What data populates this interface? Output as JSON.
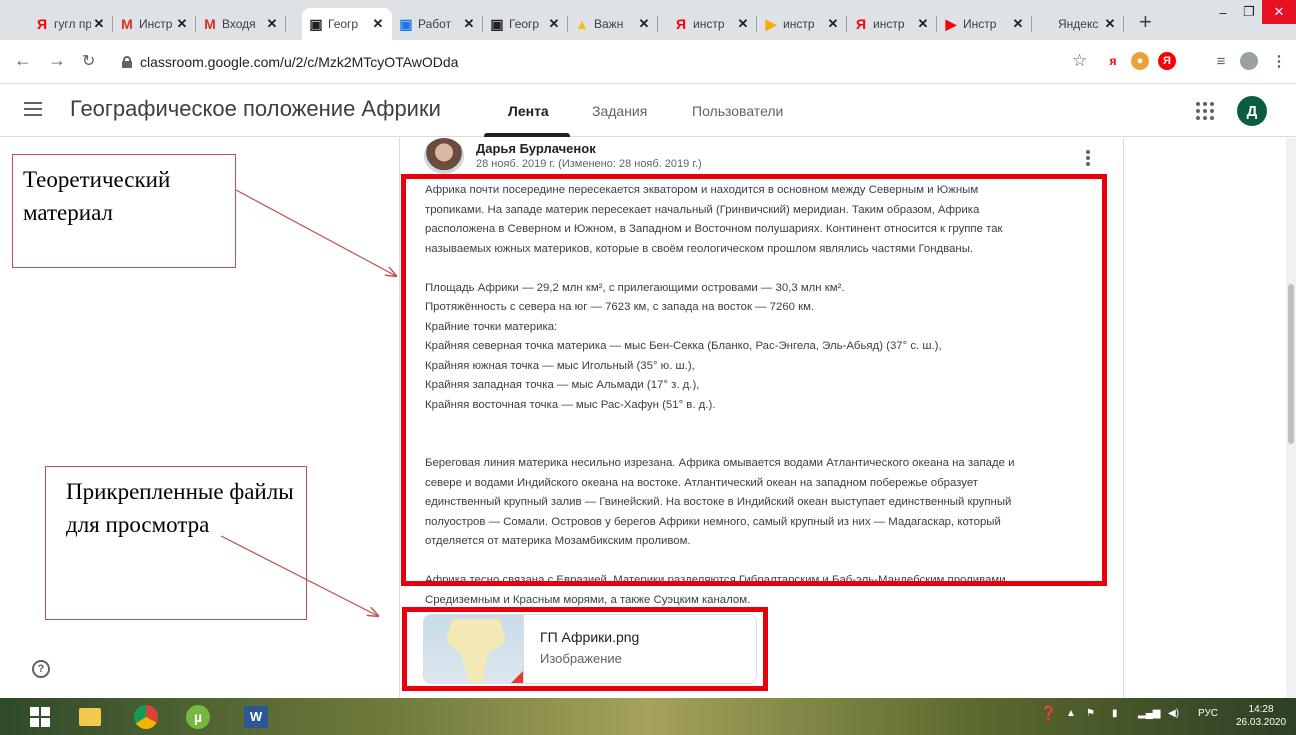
{
  "browser": {
    "tabs": [
      {
        "icon": "Я",
        "icon_color": "#ff0000",
        "title": "гугл пр",
        "active": false
      },
      {
        "icon": "M",
        "icon_color": "#d93025",
        "title": "Инстр",
        "active": false
      },
      {
        "icon": "M",
        "icon_color": "#d93025",
        "title": "Входя",
        "active": false
      },
      {
        "icon": "▣",
        "icon_color": "#202124",
        "title": "Геогр",
        "active": true
      },
      {
        "icon": "▣",
        "icon_color": "#1a73e8",
        "title": "Работ",
        "active": false
      },
      {
        "icon": "▣",
        "icon_color": "#202124",
        "title": "Геогр",
        "active": false
      },
      {
        "icon": "▲",
        "icon_color": "#fbbc04",
        "title": "Важн",
        "active": false
      },
      {
        "icon": "Я",
        "icon_color": "#ff0000",
        "title": "инстр",
        "active": false
      },
      {
        "icon": "▶",
        "icon_color": "#f9ab00",
        "title": "инстр",
        "active": false
      },
      {
        "icon": "Я",
        "icon_color": "#ff0000",
        "title": "инстр",
        "active": false
      },
      {
        "icon": "▶",
        "icon_color": "#ff0000",
        "title": "Инстр",
        "active": false
      },
      {
        "icon": "",
        "icon_color": "#202124",
        "title": "Яндекс",
        "active": false
      }
    ],
    "new_tab": "+",
    "minimize": "–",
    "maximize": "❐",
    "close": "✕",
    "url": "classroom.google.com/u/2/c/Mzk2MTcyOTAwODda",
    "star": "☆"
  },
  "header": {
    "course_title": "Географическое положение Африки",
    "tabs": [
      "Лента",
      "Задания",
      "Пользователи"
    ],
    "active_tab": "Лента",
    "avatar_letter": "Д"
  },
  "post": {
    "author": "Дарья Бурлаченок",
    "date": "28 нояб. 2019 г. (Изменено: 28 нояб. 2019 г.)",
    "paragraphs": [
      "Африка почти посередине пересекается экватором и находится в основном между Северным и Южным",
      "тропиками. На западе материк пересекает начальный (Гринвичский) меридиан. Таким образом, Африка",
      "расположена в Северном и Южном, в Западном и Восточном полушариях. Континент относится к группе так",
      "называемых южных материков, которые в своём геологическом прошлом являлись частями Гондваны.",
      "",
      "Площадь Африки — 29,2 млн км², с прилегающими островами — 30,3 млн км².",
      "Протяжённость с севера на юг — 7623 км, с запада на восток — 7260 км.",
      "Крайние точки материка:",
      "Крайняя северная точка материка — мыс Бен-Секка (Бланко, Рас-Энгела, Эль-Абьяд) (37° с. ш.),",
      "Крайняя южная точка — мыс Игольный (35° ю. ш.),",
      "Крайняя западная точка — мыс Альмади (17° з. д.),",
      "Крайняя восточная точка — мыс Рас-Хафун (51° в. д.).",
      "",
      "",
      "Береговая линия материка несильно изрезана. Африка омывается водами Атлантического океана на западе и",
      "севере и водами Индийского океана на востоке. Атлантический океан на западном побережье образует",
      "единственный крупный залив — Гвинейский. На востоке в Индийский океан выступает единственный крупный",
      "полуостров — Сомали. Островов у берегов Африки немного, самый крупный из них — Мадагаскар, который",
      "отделяется от материка Мозамбикским проливом.",
      "",
      "Африка тесно связана с Евразией. Материки разделяются Гибралтарским и Баб-эль-Мандебским проливами,",
      "Средиземным и Красным морями, а также Суэцким каналом."
    ],
    "attachment": {
      "name": "ГП Африки.png",
      "type": "Изображение"
    }
  },
  "annotations": {
    "theory": "Теоретический материал",
    "files": "Прикрепленные файлы для просмотра"
  },
  "taskbar": {
    "lang": "РУС",
    "time": "14:28",
    "date": "26.03.2020"
  },
  "colors": {
    "highlight_red": "#e8000b",
    "classroom_green": "#0b5d3e"
  }
}
